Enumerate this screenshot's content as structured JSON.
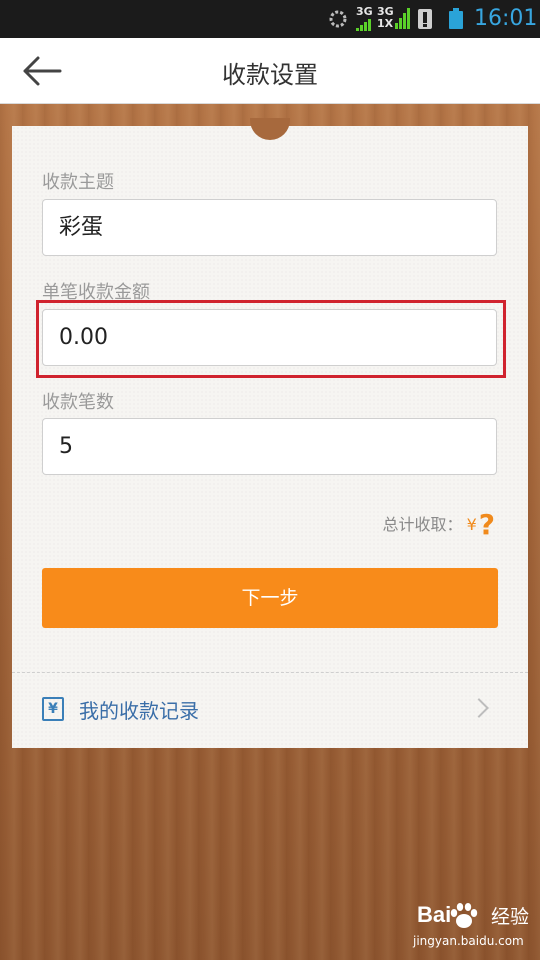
{
  "status_bar": {
    "signal_a": "3G",
    "signal_b_top": "3G",
    "signal_b_bottom": "1X",
    "time": "16:01"
  },
  "header": {
    "title": "收款设置",
    "back_icon": "arrow-left-icon"
  },
  "form": {
    "subject": {
      "label": "收款主题",
      "value": "彩蛋"
    },
    "amount": {
      "label": "单笔收款金额",
      "value": "0.00"
    },
    "count": {
      "label": "收款笔数",
      "value": "5"
    },
    "total": {
      "label": "总计收取：",
      "currency": "¥",
      "value": "?"
    },
    "next_button": "下一步"
  },
  "records_link": {
    "icon": "yen-receipt-icon",
    "label": "我的收款记录"
  },
  "watermark": {
    "brand": "Bai",
    "brand_suffix": "经验",
    "url": "jingyan.baidu.com"
  },
  "colors": {
    "accent": "#f88b1a",
    "link": "#3a6ea8",
    "highlight": "#d0232e",
    "status_time": "#38a6e0"
  }
}
